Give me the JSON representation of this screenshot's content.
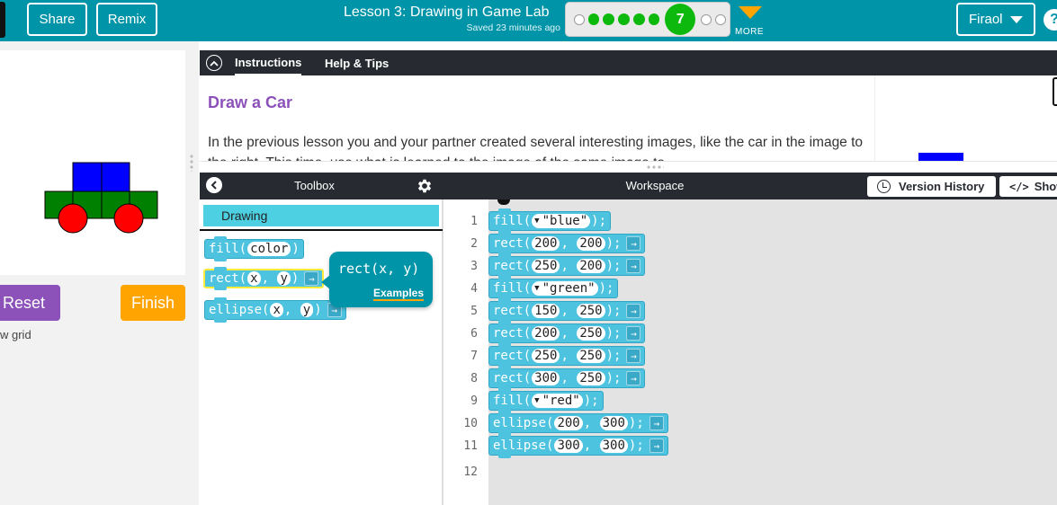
{
  "header": {
    "share_label": "Share",
    "remix_label": "Remix",
    "lesson_title": "Lesson 3: Drawing in Game Lab",
    "saved_text": "Saved 23 minutes ago",
    "progress": {
      "current_level": "7",
      "total_dots": 9
    },
    "more_label": "MORE",
    "user_name": "Firaol",
    "help_label": "?"
  },
  "preview": {
    "reset_label": "Reset",
    "finish_label": "Finish",
    "grid_label": "w grid",
    "colors": {
      "body": "#008000",
      "top": "#0000ff",
      "wheels": "#ff0000"
    }
  },
  "instructions": {
    "tab_instructions": "Instructions",
    "tab_help": "Help & Tips",
    "title": "Draw a Car",
    "text": "In the previous lesson you and your partner created several interesting images, like the car in the image to the right. This time, use what is learned to the image of the same image to"
  },
  "toolbox": {
    "title": "Toolbox",
    "category": "Drawing",
    "blocks": [
      {
        "name": "fill",
        "args": [
          "color"
        ],
        "arrow": false
      },
      {
        "name": "rect",
        "args": [
          "x",
          "y"
        ],
        "arrow": true
      },
      {
        "name": "ellipse",
        "args": [
          "x",
          "y"
        ],
        "arrow": true
      }
    ],
    "tooltip": {
      "signature": "rect(x, y)",
      "link": "Examples"
    }
  },
  "workspace": {
    "title": "Workspace",
    "version_history_label": "Version History",
    "show_code_label": "Show",
    "line_numbers": [
      "1",
      "2",
      "3",
      "4",
      "5",
      "6",
      "7",
      "8",
      "9",
      "10",
      "11",
      "12"
    ],
    "code": [
      {
        "fn": "fill",
        "color": "\"blue\""
      },
      {
        "fn": "rect",
        "args": [
          "200",
          "200"
        ]
      },
      {
        "fn": "rect",
        "args": [
          "250",
          "200"
        ]
      },
      {
        "fn": "fill",
        "color": "\"green\""
      },
      {
        "fn": "rect",
        "args": [
          "150",
          "250"
        ]
      },
      {
        "fn": "rect",
        "args": [
          "200",
          "250"
        ]
      },
      {
        "fn": "rect",
        "args": [
          "250",
          "250"
        ]
      },
      {
        "fn": "rect",
        "args": [
          "300",
          "250"
        ]
      },
      {
        "fn": "fill",
        "color": "\"red\""
      },
      {
        "fn": "ellipse",
        "args": [
          "200",
          "300"
        ]
      },
      {
        "fn": "ellipse",
        "args": [
          "300",
          "300"
        ]
      }
    ]
  }
}
